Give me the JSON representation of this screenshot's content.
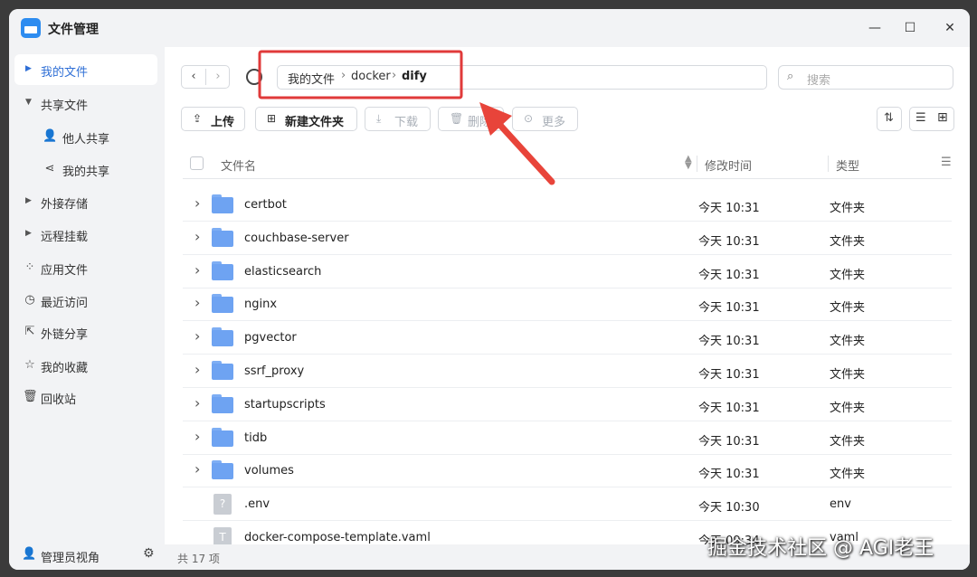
{
  "window": {
    "title": "文件管理",
    "minimize": "—",
    "maximize": "☐",
    "close": "✕"
  },
  "sidebar": {
    "items": [
      {
        "label": "我的文件",
        "icon": "caret-right-icon",
        "glyph": "▶"
      },
      {
        "label": "共享文件",
        "icon": "caret-down-icon",
        "glyph": "▼"
      },
      {
        "label": "他人共享",
        "icon": "user-icon",
        "glyph": "👤"
      },
      {
        "label": "我的共享",
        "icon": "share-icon",
        "glyph": "⋖"
      },
      {
        "label": "外接存储",
        "icon": "caret-right-icon",
        "glyph": "▶"
      },
      {
        "label": "远程挂载",
        "icon": "caret-right-icon",
        "glyph": "▶"
      },
      {
        "label": "应用文件",
        "icon": "apps-icon",
        "glyph": "⁘"
      },
      {
        "label": "最近访问",
        "icon": "clock-icon",
        "glyph": "◷"
      },
      {
        "label": "外链分享",
        "icon": "external-link-icon",
        "glyph": "⇱"
      },
      {
        "label": "我的收藏",
        "icon": "star-icon",
        "glyph": "☆"
      },
      {
        "label": "回收站",
        "icon": "trash-icon",
        "glyph": "🗑"
      }
    ],
    "admin_label": "管理员视角",
    "admin_icon": "user-icon",
    "settings_icon": "gear-icon"
  },
  "nav": {
    "back": "‹",
    "forward": "›"
  },
  "breadcrumb": {
    "items": [
      "我的文件",
      "docker",
      "dify"
    ],
    "separator": "›"
  },
  "search": {
    "placeholder": "搜索",
    "glyph": "⌕"
  },
  "toolbar": {
    "upload": {
      "label": "上传",
      "glyph": "⇪"
    },
    "new_folder": {
      "label": "新建文件夹",
      "glyph": "⊞"
    },
    "download": {
      "label": "下载",
      "glyph": "⤓"
    },
    "delete": {
      "label": "删除",
      "glyph": "🗑"
    },
    "more": {
      "label": "更多",
      "glyph": "⊙"
    },
    "sort_glyph": "⇅",
    "list_glyph": "☰",
    "grid_glyph": "⊞"
  },
  "table": {
    "headers": {
      "name": "文件名",
      "modified": "修改时间",
      "type": "类型"
    },
    "rows": [
      {
        "name": "certbot",
        "time": "今天 10:31",
        "type": "文件夹",
        "kind": "folder"
      },
      {
        "name": "couchbase-server",
        "time": "今天 10:31",
        "type": "文件夹",
        "kind": "folder"
      },
      {
        "name": "elasticsearch",
        "time": "今天 10:31",
        "type": "文件夹",
        "kind": "folder"
      },
      {
        "name": "nginx",
        "time": "今天 10:31",
        "type": "文件夹",
        "kind": "folder"
      },
      {
        "name": "pgvector",
        "time": "今天 10:31",
        "type": "文件夹",
        "kind": "folder"
      },
      {
        "name": "ssrf_proxy",
        "time": "今天 10:31",
        "type": "文件夹",
        "kind": "folder"
      },
      {
        "name": "startupscripts",
        "time": "今天 10:31",
        "type": "文件夹",
        "kind": "folder"
      },
      {
        "name": "tidb",
        "time": "今天 10:31",
        "type": "文件夹",
        "kind": "folder"
      },
      {
        "name": "volumes",
        "time": "今天 10:31",
        "type": "文件夹",
        "kind": "folder"
      },
      {
        "name": ".env",
        "time": "今天 10:30",
        "type": "env",
        "kind": "file",
        "glyph": "?"
      },
      {
        "name": "docker-compose-template.vaml",
        "time": "今天 09:34",
        "type": "vaml",
        "kind": "file",
        "glyph": "T"
      }
    ]
  },
  "status": {
    "count": "共 17 项"
  },
  "watermark": "掘金技术社区 @ AGI老王",
  "colors": {
    "accent": "#2f6fd6",
    "folder": "#6ea3f2",
    "highlight": "#e03a3a",
    "arrow": "#e8443a"
  }
}
